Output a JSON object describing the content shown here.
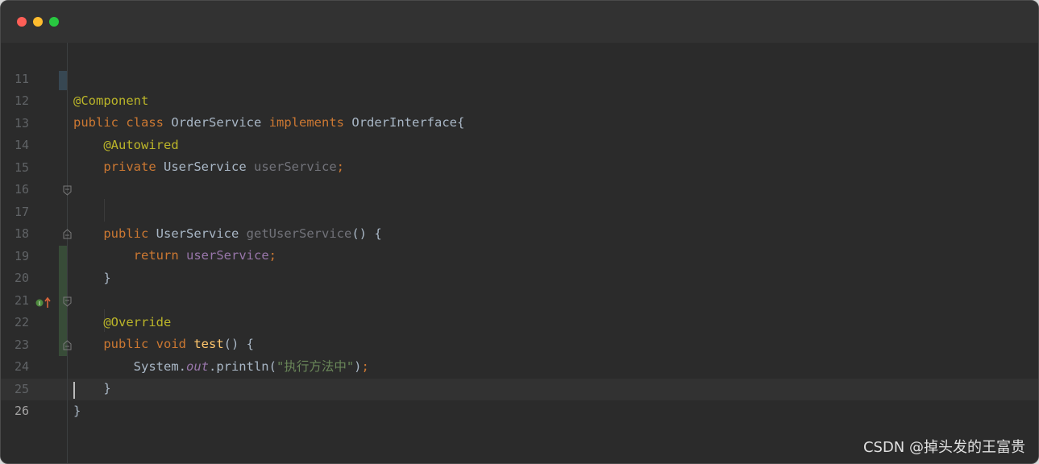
{
  "watermark": "CSDN @掉头发的王富贵",
  "editor": {
    "lines": [
      {
        "n": "11"
      },
      {
        "n": "12"
      },
      {
        "n": "13"
      },
      {
        "n": "14"
      },
      {
        "n": "15"
      },
      {
        "n": "16"
      },
      {
        "n": "17"
      },
      {
        "n": "18"
      },
      {
        "n": "19"
      },
      {
        "n": "20"
      },
      {
        "n": "21"
      },
      {
        "n": "22"
      },
      {
        "n": "23"
      },
      {
        "n": "24"
      },
      {
        "n": "25"
      },
      {
        "n": "26"
      }
    ],
    "code": {
      "l11": {
        "ann": "@Component"
      },
      "l12": {
        "kw1": "public",
        "kw2": "class",
        "name": "OrderService",
        "kw3": "implements",
        "iface": "OrderInterface{"
      },
      "l13": {
        "ann": "@Autowired"
      },
      "l14": {
        "kw": "private",
        "type": "UserService",
        "field": "userService",
        "semi": ";"
      },
      "l17": {
        "kw": "public",
        "type": "UserService",
        "method": "getUserService",
        "rest": "() {"
      },
      "l18": {
        "kw": "return",
        "field": "userService",
        "semi": ";"
      },
      "l19": {
        "brace": "}"
      },
      "l21": {
        "ann": "@Override"
      },
      "l22": {
        "kw1": "public",
        "kw2": "void",
        "method": "test",
        "rest": "() {"
      },
      "l23": {
        "cls": "System.",
        "static": "out",
        "call": ".println(",
        "str": "\"执行方法中\"",
        "end": ")",
        "semi": ";"
      },
      "l24": {
        "brace": "}"
      },
      "l25": {
        "brace": "}"
      }
    },
    "current_line": "26"
  },
  "colors": {
    "keyword": "#cc7832",
    "annotation": "#bbb529",
    "field": "#9876aa",
    "string": "#6a8759",
    "method": "#ffc66d",
    "text": "#a9b7c6"
  }
}
